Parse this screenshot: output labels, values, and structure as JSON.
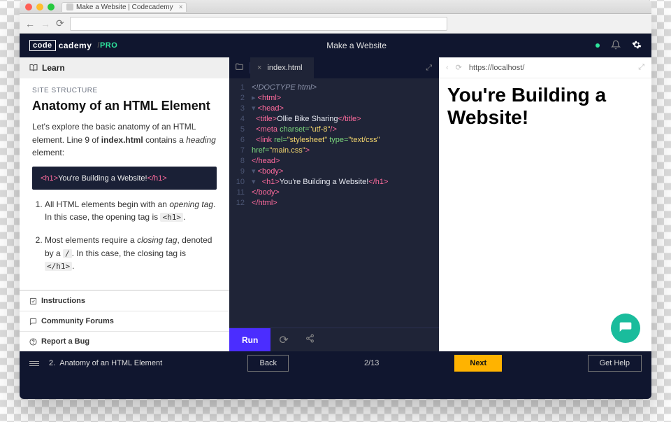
{
  "browser": {
    "tab_title": "Make a Website | Codecademy",
    "url": ""
  },
  "header": {
    "logo_prefix": "code",
    "logo_suffix": "cademy",
    "logo_badge": "PRO",
    "title": "Make a Website"
  },
  "lesson": {
    "learn_label": "Learn",
    "eyebrow": "SITE STRUCTURE",
    "title": "Anatomy of an HTML Element",
    "intro_1": "Let's explore the basic anatomy of an HTML element. Line 9 of ",
    "intro_file": "index.html",
    "intro_2": " contains a ",
    "intro_em": "heading",
    "intro_3": " element:",
    "code_example_tag_open": "<h1>",
    "code_example_text": "You're Building a Website!",
    "code_example_tag_close": "</h1>",
    "li1_a": "All HTML elements begin with an ",
    "li1_em": "opening tag",
    "li1_b": ". In this case, the opening tag is ",
    "li1_code": "<h1>",
    "li1_c": ".",
    "li2_a": "Most elements require a ",
    "li2_em": "closing tag",
    "li2_b": ", denoted by a ",
    "li2_code1": "/",
    "li2_c": ". In this case, the closing tag is ",
    "li2_code2": "</h1>",
    "li2_d": ".",
    "tabs": {
      "instructions": "Instructions",
      "forums": "Community Forums",
      "bug": "Report a Bug"
    }
  },
  "editor": {
    "filename": "index.html",
    "run": "Run",
    "lines": [
      "1",
      "2",
      "3",
      "4",
      "5",
      "6",
      "7",
      "8",
      "9",
      "10",
      "11",
      "12"
    ]
  },
  "preview": {
    "url": "https://localhost/",
    "heading": "You're Building a Website!"
  },
  "footer": {
    "lesson_num": "2.",
    "lesson_title": "Anatomy of an HTML Element",
    "back": "Back",
    "progress": "2/13",
    "next": "Next",
    "help": "Get Help"
  }
}
